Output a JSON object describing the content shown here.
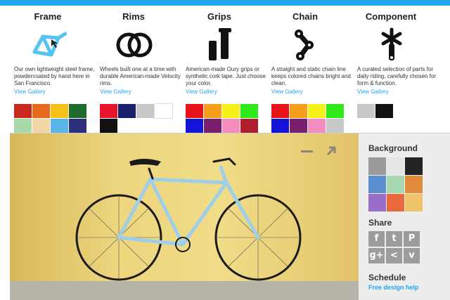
{
  "columns": [
    {
      "title": "Frame",
      "icon": "bike-frame-icon",
      "desc": "Our own lightweight steel frame, powdercoated by hand here in San Francisco.",
      "link": "View Gallery",
      "swatches": [
        "#c8281e",
        "#e56a1c",
        "#f6c21a",
        "#1f6b2e",
        "#a7d9a9",
        "#f3d6a8",
        "#59b4e8",
        "#2c2f7a"
      ]
    },
    {
      "title": "Rims",
      "icon": "rims-icon",
      "desc": "Wheels built one at a time with durable American-made Velocity rims.",
      "link": "View Gallery",
      "swatches": [
        "#e8142c",
        "#1b1f6b",
        "#c8c8c8",
        "#ffffff",
        "#111111"
      ]
    },
    {
      "title": "Grips",
      "icon": "grips-icon",
      "desc": "American-made Oury grips or synthetic cork tape. Just choose your color.",
      "link": "View Gallery",
      "swatches": [
        "#e8141c",
        "#f59e1a",
        "#f5ef1a",
        "#2ee81a",
        "#1414d8",
        "#7a1e6e",
        "#f28dbd",
        "#b01e2e"
      ]
    },
    {
      "title": "Chain",
      "icon": "chain-icon",
      "desc": "A straight and static chain line keeps colored chains bright and clean.",
      "link": "View Gallery",
      "swatches": [
        "#e8141c",
        "#f59e1a",
        "#f5ef1a",
        "#2ee81a",
        "#1414d8",
        "#7a1e6e",
        "#f28dbd",
        "#c8c8c8"
      ]
    },
    {
      "title": "Component",
      "icon": "component-icon",
      "desc": "A curated selection of parts for daily riding, carefully chosen for form & function.",
      "link": "View Gallery",
      "swatches": [
        "#c8c8c8",
        "#111111"
      ]
    }
  ],
  "sidebar": {
    "background_title": "Background",
    "background_swatches": [
      "#9a9a9a",
      "#e6e6e6",
      "#222222",
      "#5b90d0",
      "#a8d8b0",
      "#e08a3c",
      "#9a6ec8",
      "#e86a3c",
      "#f0c46a"
    ],
    "share_title": "Share",
    "share_buttons": [
      {
        "icon": "facebook-icon",
        "glyph": "f"
      },
      {
        "icon": "twitter-icon",
        "glyph": "t"
      },
      {
        "icon": "pinterest-icon",
        "glyph": "P"
      },
      {
        "icon": "google-plus-icon",
        "glyph": "g+"
      },
      {
        "icon": "share-icon",
        "glyph": "<"
      },
      {
        "icon": "download-icon",
        "glyph": "v"
      }
    ],
    "schedule_title": "Schedule",
    "schedule_link": "Free design help"
  },
  "colors": {
    "accent": "#1fa8ee",
    "frame_icon": "#56c4f2"
  }
}
